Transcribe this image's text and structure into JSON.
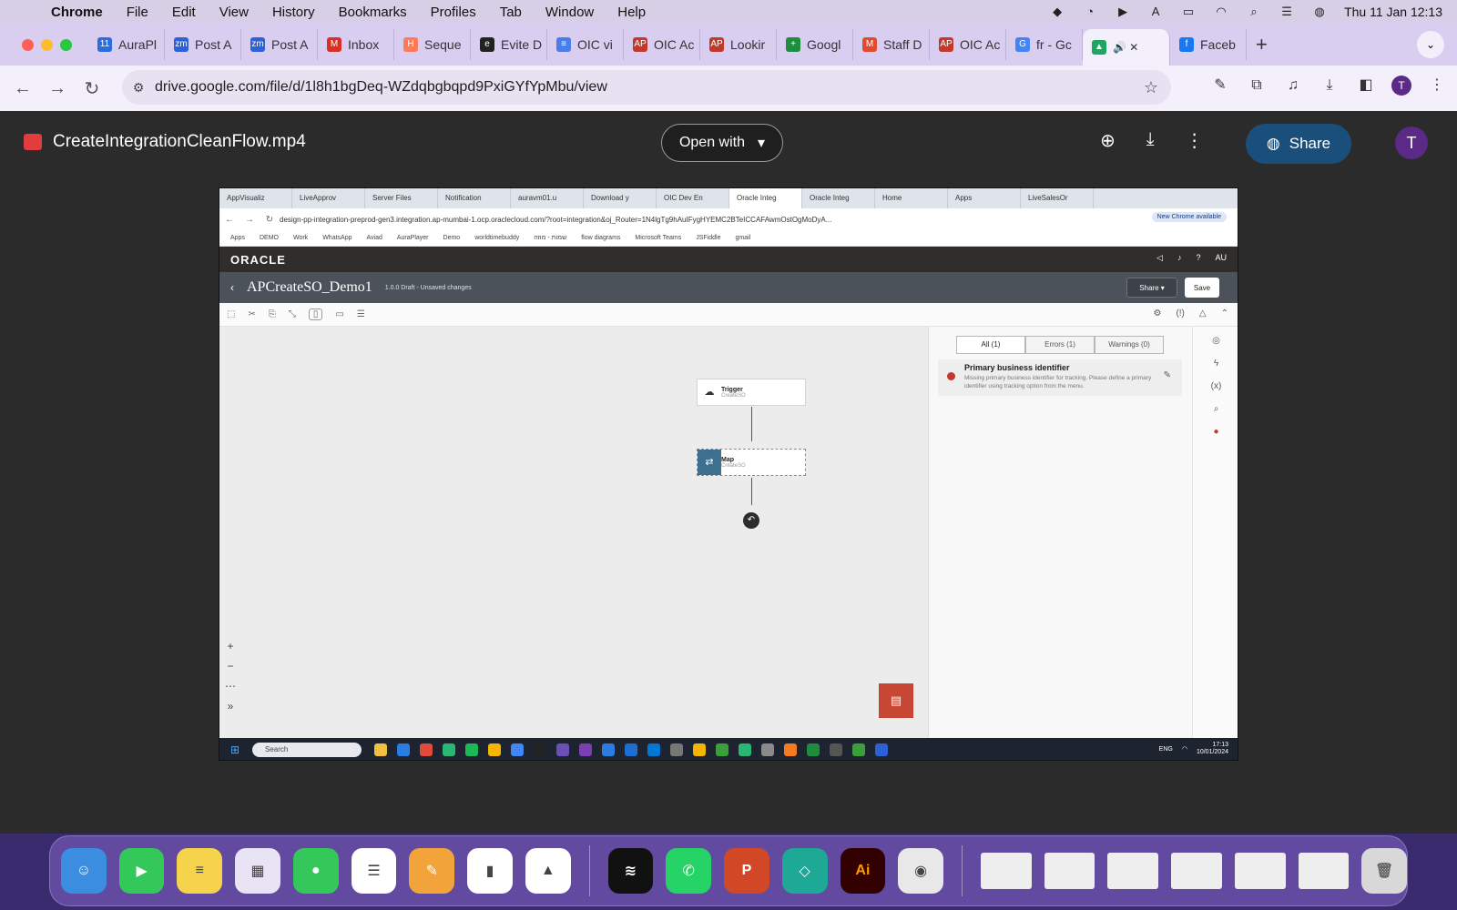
{
  "menubar": {
    "app": "Chrome",
    "items": [
      "File",
      "Edit",
      "View",
      "History",
      "Bookmarks",
      "Profiles",
      "Tab",
      "Window",
      "Help"
    ],
    "datetime": "Thu 11 Jan  12:13"
  },
  "browser": {
    "tabs": [
      {
        "label": "AuraPl",
        "color": "#2d6cdf",
        "glyph": "11"
      },
      {
        "label": "Post A",
        "color": "#2d62d6",
        "glyph": "zm"
      },
      {
        "label": "Post A",
        "color": "#2d62d6",
        "glyph": "zm"
      },
      {
        "label": "Inbox",
        "color": "#d93025",
        "glyph": "M"
      },
      {
        "label": "Seque",
        "color": "#ff7a59",
        "glyph": "H"
      },
      {
        "label": "Evite D",
        "color": "#222222",
        "glyph": "e"
      },
      {
        "label": "OIC vi",
        "color": "#4a7de8",
        "glyph": "≡"
      },
      {
        "label": "OIC Ac",
        "color": "#c0392b",
        "glyph": "AP"
      },
      {
        "label": "Lookir",
        "color": "#c0392b",
        "glyph": "AP"
      },
      {
        "label": "Googl",
        "color": "#1e8e3e",
        "glyph": "+"
      },
      {
        "label": "Staff D",
        "color": "#e34b30",
        "glyph": "M"
      },
      {
        "label": "OIC Ac",
        "color": "#c0392b",
        "glyph": "AP"
      },
      {
        "label": "fr - Gc",
        "color": "#4285f4",
        "glyph": "G"
      },
      {
        "label": "",
        "color": "#1fa463",
        "glyph": "▲",
        "active": true
      },
      {
        "label": "Faceb",
        "color": "#1877f2",
        "glyph": "f"
      }
    ],
    "url": "drive.google.com/file/d/1l8h1bgDeq-WZdqbgbqpd9PxiGYfYpMbu/view",
    "profile_initial": "T"
  },
  "drive": {
    "filename": "CreateIntegrationCleanFlow.mp4",
    "open_with": "Open with",
    "share": "Share",
    "avatar": "T"
  },
  "video": {
    "tabs": [
      "AppVisualiz",
      "LiveApprov",
      "Server Files",
      "Notification",
      "auravm01.u",
      "Download y",
      "OIC Dev En",
      "Oracle Integ",
      "Oracle Integ",
      "Home",
      "Apps",
      "LiveSalesOr"
    ],
    "url": "design-pp-integration-preprod-gen3.integration.ap-mumbai-1.ocp.oraclecloud.com/?root=integration&oj_Router=1N4lgTg9hAuIFygHYEMC2BTeICCAFAwmOstOgMoDyA...",
    "new_chrome": "New Chrome available",
    "bookmarks": [
      "Apps",
      "DEMO",
      "Work",
      "WhatsApp",
      "Aviad",
      "AuraPlayer",
      "Demo",
      "worldtimebuddy",
      "שמות - מוזה",
      "flow diagrams",
      "Microsoft Teams",
      "JSFiddle",
      "gmail"
    ],
    "oracle_logo": "ORACLE",
    "user_initials": "AU",
    "integration_name": "APCreateSO_Demo1",
    "version_status": "1.0.0 Draft - Unsaved changes",
    "share": "Share",
    "save": "Save",
    "filters": [
      "All (1)",
      "Errors (1)",
      "Warnings (0)"
    ],
    "issue_title": "Primary business identifier",
    "issue_desc": "Missing primary business identifier for tracking. Please define a primary identifier using tracking option from the menu.",
    "nodes": [
      {
        "title": "Trigger",
        "sub": "CreateSO"
      },
      {
        "title": "Map",
        "sub": "CreateSO"
      }
    ],
    "taskbar_search": "Search",
    "taskbar_lang": "ENG",
    "taskbar_time": "17:13",
    "taskbar_date": "10/01/2024"
  },
  "dock": {
    "apps": [
      {
        "name": "Finder",
        "color": "#3b8de0",
        "glyph": "☺"
      },
      {
        "name": "FaceTime",
        "color": "#34c759",
        "glyph": "▶"
      },
      {
        "name": "Notes",
        "color": "#f5d34a",
        "glyph": "≡"
      },
      {
        "name": "Launchpad",
        "color": "#e9e3f6",
        "glyph": "▦"
      },
      {
        "name": "Messages",
        "color": "#34c759",
        "glyph": "●"
      },
      {
        "name": "Reminders",
        "color": "#ffffff",
        "glyph": "☰"
      },
      {
        "name": "Pages",
        "color": "#f2a33a",
        "glyph": "✎"
      },
      {
        "name": "Numbers",
        "color": "#ffffff",
        "glyph": "▮"
      },
      {
        "name": "Keynote",
        "color": "#ffffff",
        "glyph": "▲"
      },
      {
        "name": "Spotify",
        "color": "#111111",
        "glyph": "≋"
      },
      {
        "name": "WhatsApp",
        "color": "#25d366",
        "glyph": "✆"
      },
      {
        "name": "PowerPoint",
        "color": "#d24726",
        "glyph": "P"
      },
      {
        "name": "Surfshark",
        "color": "#1ea896",
        "glyph": "◇"
      },
      {
        "name": "Illustrator",
        "color": "#330000",
        "glyph": "Ai"
      },
      {
        "name": "Chrome",
        "color": "#e8e8e8",
        "glyph": "◉"
      }
    ]
  }
}
